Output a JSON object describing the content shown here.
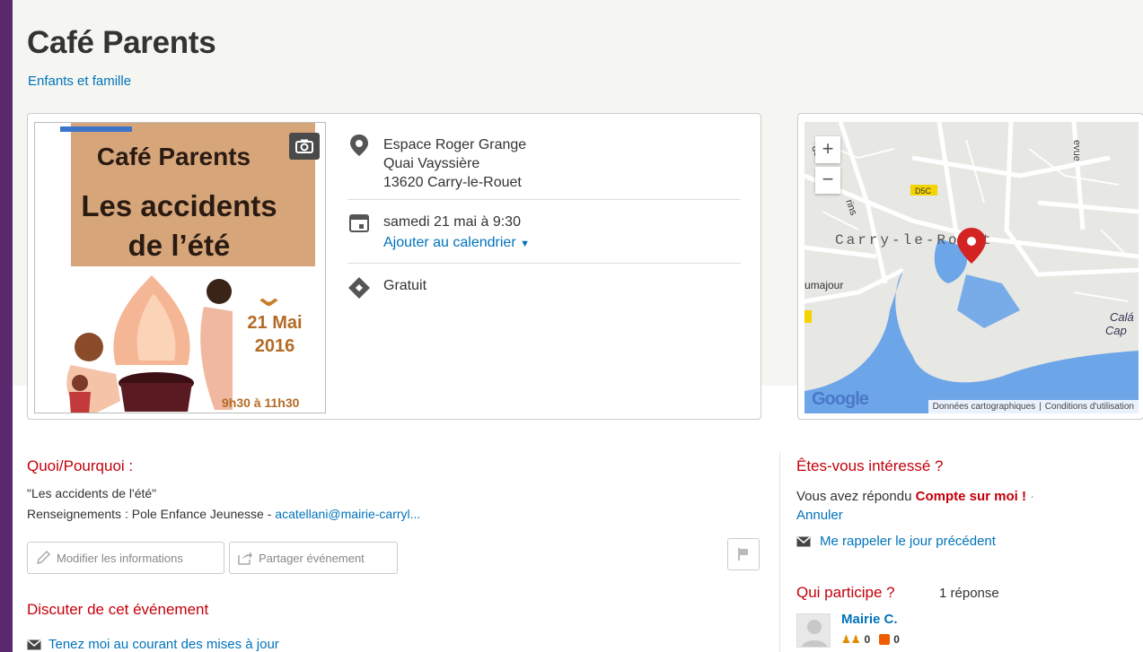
{
  "event": {
    "title": "Café Parents",
    "category": "Enfants et famille"
  },
  "poster": {
    "line1": "Café Parents",
    "line2": "Les accidents",
    "line3": "de l’été",
    "date_line1": "21 Mai",
    "date_line2": "2016",
    "time": "9h30 à 11h30"
  },
  "details": {
    "address": {
      "venue": "Espace Roger Grange",
      "street": "Quai Vayssière",
      "city": "13620 Carry-le-Rouet"
    },
    "date": "samedi 21 mai à 9:30",
    "add_calendar": "Ajouter au calendrier",
    "price": "Gratuit"
  },
  "map": {
    "zoom_in": "+",
    "zoom_out": "−",
    "town_label": "Carry-le-Rouet",
    "road_label": "D5C",
    "label_left": "umajour",
    "label_right1": "Calá",
    "label_right2": "Cap",
    "label_top": "evue",
    "label_left_top": "de",
    "label_left_mid": "rins",
    "google": "Google",
    "attrib_data": "Données cartographiques",
    "attrib_terms": "Conditions d'utilisation"
  },
  "about": {
    "title": "Quoi/Pourquoi :",
    "line1": "\"Les accidents de l'été\"",
    "line2_prefix": "Renseignements : Pole Enfance Jeunesse - ",
    "email": "acatellani@mairie-carryl..."
  },
  "actions": {
    "edit": "Modifier les informations",
    "share": "Partager événement"
  },
  "discuss": {
    "title": "Discuter de cet événement",
    "notify": "Tenez moi au courant des mises à jour"
  },
  "interest": {
    "title": "Êtes-vous intéressé ?",
    "answered_prefix": "Vous avez répondu ",
    "answer": "Compte sur moi !",
    "dot": "·",
    "cancel": "Annuler",
    "remind": "Me rappeler le jour précédent"
  },
  "attendees": {
    "title": "Qui participe ?",
    "count": "1 réponse",
    "users": [
      {
        "name": "Mairie C.",
        "friends": "0",
        "reviews": "0"
      }
    ]
  },
  "colors": {
    "accent_red": "#c4000a",
    "link_blue": "#0073bb",
    "frame_purple": "#5b2a6e"
  }
}
